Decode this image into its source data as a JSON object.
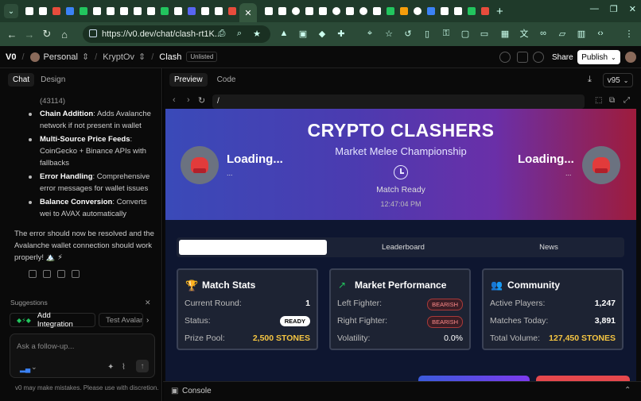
{
  "browser": {
    "url": "https://v0.dev/chat/clash-rt1K...",
    "tab_label": "v0",
    "fav_colors": [
      "#ffffff",
      "#ffffff",
      "#e74c3c",
      "#3b82f6",
      "#22c55e",
      "#ffffff",
      "#ffffff",
      "#ffffff",
      "#ffffff",
      "#ffffff",
      "#22c55e"
    ]
  },
  "app": {
    "logo": "V0",
    "workspace": "Personal",
    "user": "KryptOv",
    "project": "Clash",
    "visibility": "Unlisted",
    "share": "Share",
    "publish": "Publish"
  },
  "left": {
    "tabs": [
      "Chat",
      "Design"
    ],
    "prev": "(43114)",
    "bullets": [
      {
        "b": "Chain Addition",
        "t": ": Adds Avalanche network if not present in wallet"
      },
      {
        "b": "Multi-Source Price Feeds",
        "t": ": CoinGecko + Binance APIs with fallbacks"
      },
      {
        "b": "Error Handling",
        "t": ": Comprehensive error messages for wallet issues"
      },
      {
        "b": "Balance Conversion",
        "t": ": Converts wei to AVAX automatically"
      }
    ],
    "closing": "The error should now be resolved and the Avalanche wallet connection should work properly! 🏔️ ⚡",
    "suggestions_label": "Suggestions",
    "chip1": "Add Integration",
    "chip2": "Test Avalan",
    "placeholder": "Ask a follow-up...",
    "disclaimer": "v0 may make mistakes. Please use with discretion."
  },
  "right": {
    "tabs": [
      "Preview",
      "Code"
    ],
    "version": "v95",
    "path": "/",
    "console": "Console"
  },
  "game": {
    "title": "CRYPTO CLASHERS",
    "subtitle": "Market Melee Championship",
    "left_status": "Loading...",
    "right_status": "Loading...",
    "dots": "...",
    "match_status": "Match Ready",
    "time": "12:47:04 PM",
    "tabs": [
      "",
      "Leaderboard",
      "News"
    ],
    "match": {
      "title": "Match Stats",
      "rows": [
        [
          "Current Round:",
          "1"
        ],
        [
          "Status:",
          "READY"
        ],
        [
          "Prize Pool:",
          "2,500 STONES"
        ]
      ]
    },
    "market": {
      "title": "Market Performance",
      "rows": [
        [
          "Left Fighter:",
          "BEARISH"
        ],
        [
          "Right Fighter:",
          "BEARISH"
        ],
        [
          "Volatility:",
          "0.0%"
        ]
      ]
    },
    "community": {
      "title": "Community",
      "rows": [
        [
          "Active Players:",
          "1,247"
        ],
        [
          "Matches Today:",
          "3,891"
        ],
        [
          "Total Volume:",
          "127,450 STONES"
        ]
      ]
    },
    "accent_gold": "#f5c542"
  }
}
